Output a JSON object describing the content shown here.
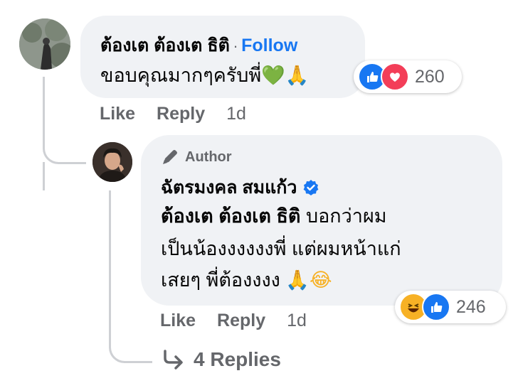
{
  "comment1": {
    "name": "ต้องเต ต้องเต ธิติ",
    "separator": "·",
    "follow_label": "Follow",
    "text": "ขอบคุณมากๆครับพี่",
    "emoji_heart": "💚",
    "emoji_pray": "🙏",
    "reaction_icons": [
      "like-icon",
      "love-icon"
    ],
    "reaction_count": "260",
    "actions": {
      "like": "Like",
      "reply": "Reply",
      "time": "1d"
    }
  },
  "comment2": {
    "badge_label": "Author",
    "badge_icon": "pencil-icon",
    "name": "ฉัตรมงคล สมแก้ว",
    "verified_icon": "verified-check-icon",
    "mention": "ต้องเต ต้องเต ธิติ",
    "text_line1": "บอกว่าผม",
    "text_line2": "เป็นน้องงงงงงพี่ แต่ผมหน้าแก่",
    "text_line3": "เสยๆ พี่ต้องงงง",
    "emoji_pray": "🙏",
    "emoji_laugh": "😂",
    "reaction_icons": [
      "haha-icon",
      "like-icon"
    ],
    "reaction_count": "246",
    "actions": {
      "like": "Like",
      "reply": "Reply",
      "time": "1d"
    }
  },
  "more_replies": {
    "arrow_icon": "reply-arrow-icon",
    "label": "4 Replies"
  },
  "colors": {
    "link": "#1877f2",
    "like_blue": "#1877f2",
    "love_red": "#f33e58",
    "haha_yellow": "#f7b125",
    "bubble": "#f0f2f5",
    "muted": "#65676b"
  }
}
